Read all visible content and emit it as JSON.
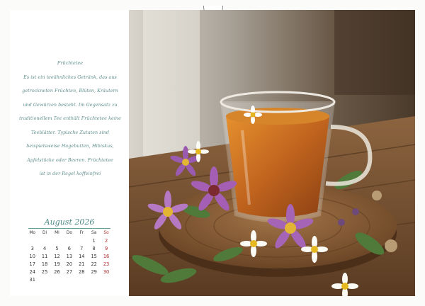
{
  "text": {
    "lines": [
      "Früchtetee",
      "Es ist ein teeähnliches Getränk, das aus",
      "getrockneten Früchten, Blüten, Kräutern",
      "und Gewürzen besteht. Im Gegensatz zu",
      "traditionellem Tee enthält Früchtetee keine",
      "Teeblätter. Typische Zutaten sind",
      "beispielsweise Hagebutten, Hibiskus,",
      "Apfelstücke oder Beeren. Früchtetee",
      "ist in der Regel koffeinfrei"
    ]
  },
  "calendar": {
    "title": "August 2026",
    "headers": [
      "Mo",
      "Di",
      "Mi",
      "Do",
      "Fr",
      "Sa",
      "So"
    ],
    "weeks": [
      [
        "",
        "",
        "",
        "",
        "",
        "1",
        "2"
      ],
      [
        "3",
        "4",
        "5",
        "6",
        "7",
        "8",
        "9"
      ],
      [
        "10",
        "11",
        "12",
        "13",
        "14",
        "15",
        "16"
      ],
      [
        "17",
        "18",
        "19",
        "20",
        "21",
        "22",
        "23"
      ],
      [
        "24",
        "25",
        "26",
        "27",
        "28",
        "29",
        "30"
      ],
      [
        "31",
        "",
        "",
        "",
        "",
        "",
        ""
      ]
    ]
  },
  "colors": {
    "accent_text": "#5f8f8c",
    "sunday": "#b02a2a",
    "tea": "#c0641e",
    "wood": "#7a5233"
  }
}
